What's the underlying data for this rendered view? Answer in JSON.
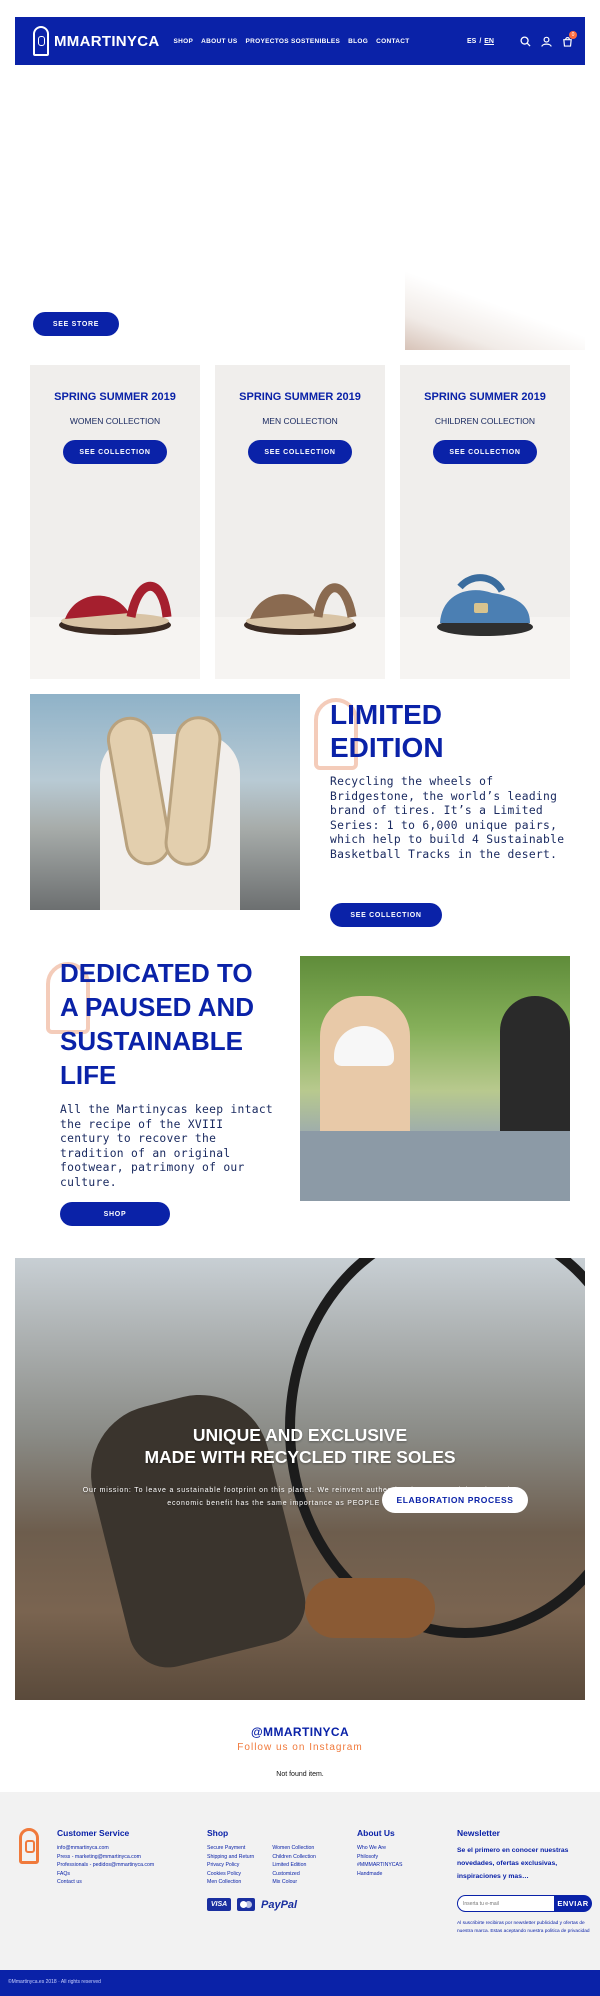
{
  "header": {
    "brand": "MMARTINYCA",
    "nav": [
      "SHOP",
      "ABOUT US",
      "PROYECTOS SOSTENIBLES",
      "BLOG",
      "CONTACT"
    ],
    "lang_es": "ES",
    "lang_sep": "/",
    "lang_en": "EN",
    "cart_count": "0"
  },
  "hero": {
    "button": "SEE STORE"
  },
  "collections": [
    {
      "season": "SPRING SUMMER 2019",
      "name": "WOMEN COLLECTION",
      "button": "SEE COLLECTION",
      "color": "#a51f2e"
    },
    {
      "season": "SPRING SUMMER 2019",
      "name": "MEN COLLECTION",
      "button": "SEE COLLECTION",
      "color": "#8a6a50"
    },
    {
      "season": "SPRING SUMMER 2019",
      "name": "CHILDREN COLLECTION",
      "button": "SEE COLLECTION",
      "color": "#4b7fb3"
    }
  ],
  "limited": {
    "title_line1": "LIMITED",
    "title_line2": "EDITION",
    "body": "Recycling the wheels of Bridgestone, the world’s leading brand of tires. It’s a Limited Series: 1 to 6,000 unique pairs, which help to build 4 Sustainable Basketball Tracks in the desert.",
    "button": "SEE COLLECTION"
  },
  "dedicated": {
    "title_line1": "DEDICATED TO",
    "title_line2": "A PAUSED AND",
    "title_line3": "SUSTAINABLE",
    "title_line4": "LIFE",
    "body": "All the Martinycas keep intact the recipe of the XVIII century to recover the tradition of an original footwear, patrimony of our culture.",
    "button": "SHOP"
  },
  "banner": {
    "title_line1": "UNIQUE AND EXCLUSIVE",
    "title_line2": "MADE WITH RECYCLED TIRE SOLES",
    "mission_line1": "Our mission: To leave a sustainable footprint on this planet. We reinvent authentic Minorcan sandals. Where the",
    "mission_line2": "economic benefit has the same importance as PEOPLE and NATURE",
    "button": "ELABORATION PROCESS"
  },
  "instagram": {
    "handle": "@MMARTINYCA",
    "follow": "Follow us on Instagram",
    "empty": "Not found item."
  },
  "footer": {
    "customer_service": {
      "heading": "Customer Service",
      "links": [
        "info@mmartinyca.com",
        "Press - marketing@mmartinyca.com",
        "Professionals - pedidos@mmartinyca.com",
        "FAQs",
        "Contact us"
      ]
    },
    "shop": {
      "heading": "Shop",
      "links_a": [
        "Secure Payment",
        "Shipping and Return",
        "Privacy Policy",
        "Cookies Policy",
        "Men Collection"
      ],
      "links_b": [
        "Women Collection",
        "Children Collection",
        "Limited Edition",
        "Customized",
        "Mix Colour"
      ]
    },
    "about": {
      "heading": "About Us",
      "links": [
        "Who We Are",
        "Philosofy",
        "#MMMARTINYCAS",
        "Handmade"
      ]
    },
    "newsletter": {
      "heading": "Newsletter",
      "text": "Se el primero en conocer nuestras novedades, ofertas exclusivas, inspiraciones y mas…",
      "placeholder": "Inserta tu e-mail",
      "button": "ENVIAR",
      "legal": "Al suscribirte recibiras por newsletter publicidad y ofertas de nuestra marca. Estas aceptando nuestra politica de privacidad"
    },
    "payments": {
      "visa": "VISA",
      "paypal": "PayPal"
    },
    "copyright": "©Mmartinyca.es 2018 · All rights reserved"
  }
}
